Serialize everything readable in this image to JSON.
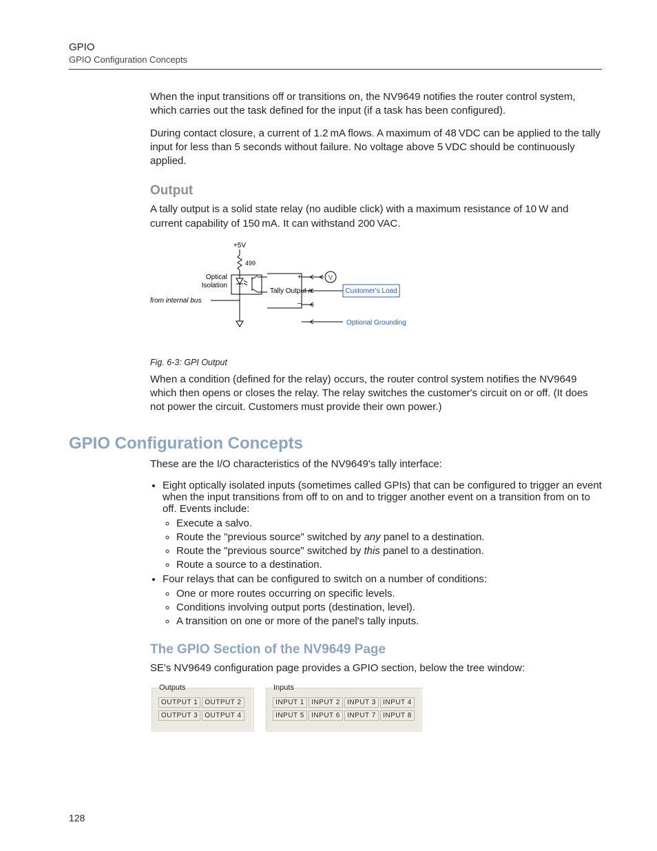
{
  "header": {
    "title": "GPIO",
    "subtitle": "GPIO Configuration Concepts"
  },
  "intro": {
    "p1": "When the input transitions off or transitions on, the NV9649 notifies the router control system, which carries out the task defined for the input (if a task has been configured).",
    "p2": "During contact closure, a current of 1.2 mA flows. A maximum of 48 VDC can be applied to the tally input for less than 5 seconds without failure. No voltage above 5 VDC should be continuously applied."
  },
  "output_section": {
    "heading": "Output",
    "p1": "A tally output is a solid state relay (no audible click) with a maximum resistance of 10 W and current capability of 150 mA. It can withstand 200 VAC.",
    "fig_caption": "Fig. 6-3: GPI Output",
    "p2": "When a condition (defined for the relay) occurs, the router control system notifies the NV9649 which then opens or closes the relay. The relay switches the customer's circuit on or off. (It does not power the circuit. Customers must provide their own power.)"
  },
  "schematic": {
    "v5": "+5V",
    "r": "499",
    "optical": "Optical",
    "isolation": "Isolation",
    "from_bus": "from internal bus",
    "tally_out": "Tally Output ",
    "tally_n": "n",
    "plus": "+",
    "minus": "–",
    "V": "V",
    "customers_load": "Customer's Load",
    "optional_ground": "Optional Grounding"
  },
  "gpio": {
    "heading": "GPIO Configuration Concepts",
    "intro": "These are the I/O characteristics of the NV9649's tally interface:",
    "bullet1_pre": "Eight optically isolated inputs (sometimes called GPIs) that can be configured to trigger an event when the input transitions from off to on and to trigger another event on a transition from on to off. Events include:",
    "sub1a": "Execute a salvo.",
    "sub1b_pre": "Route the \"previous source\" switched by ",
    "sub1b_em": "any",
    "sub1b_post": " panel to a destination.",
    "sub1c_pre": "Route the \"previous source\" switched by ",
    "sub1c_em": "this",
    "sub1c_post": " panel to a destination.",
    "sub1d": "Route a source to a destination.",
    "bullet2": "Four relays that can be configured to switch on a number of conditions:",
    "sub2a": "One or more routes occurring on specific levels.",
    "sub2b": "Conditions involving output ports (destination, level).",
    "sub2c": "A transition on one or more of the panel's tally inputs."
  },
  "gpio_section": {
    "heading": "The GPIO Section of the NV9649 Page",
    "intro": "SE's NV9649 configuration page provides a GPIO section, below the tree window:"
  },
  "cfg": {
    "outputs_legend": "Outputs",
    "inputs_legend": "Inputs",
    "outputs": [
      "OUTPUT 1",
      "OUTPUT 2",
      "OUTPUT 3",
      "OUTPUT 4"
    ],
    "inputs": [
      "INPUT 1",
      "INPUT 2",
      "INPUT 3",
      "INPUT 4",
      "INPUT 5",
      "INPUT 6",
      "INPUT 7",
      "INPUT 8"
    ]
  },
  "page_number": "128"
}
